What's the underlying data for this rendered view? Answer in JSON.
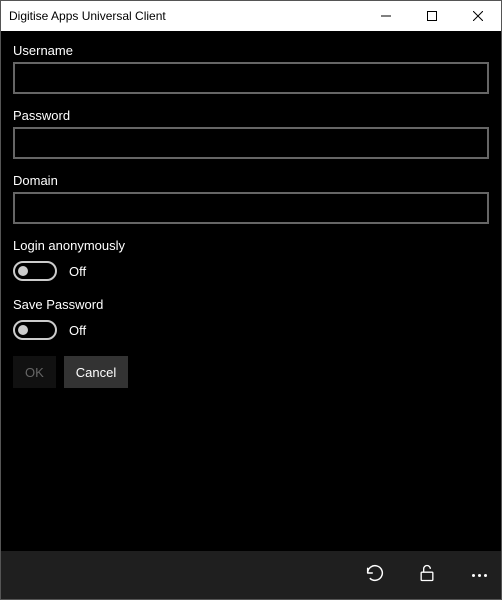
{
  "window": {
    "title": "Digitise Apps Universal Client"
  },
  "form": {
    "username": {
      "label": "Username",
      "value": ""
    },
    "password": {
      "label": "Password",
      "value": ""
    },
    "domain": {
      "label": "Domain",
      "value": ""
    },
    "login_anonymously": {
      "label": "Login anonymously",
      "state": "Off",
      "value": false
    },
    "save_password": {
      "label": "Save Password",
      "state": "Off",
      "value": false
    }
  },
  "buttons": {
    "ok": "OK",
    "cancel": "Cancel"
  }
}
